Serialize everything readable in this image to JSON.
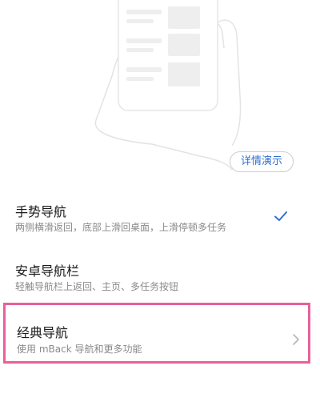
{
  "demo": {
    "label": "详情演示"
  },
  "options": [
    {
      "title": "手势导航",
      "description": "两侧横滑返回，底部上滑回桌面，上滑停顿多任务",
      "selected": true,
      "icon": "check-icon"
    },
    {
      "title": "安卓导航栏",
      "description": "轻触导航栏上返回、主页、多任务按钮",
      "selected": false
    },
    {
      "title": "经典导航",
      "description": "使用 mBack 导航和更多功能",
      "selected": false,
      "icon": "chevron-right-icon",
      "highlighted": true
    }
  ],
  "colors": {
    "accent": "#2f6fd1",
    "highlight_border": "#e8609a",
    "title_text": "#1a1a1a",
    "desc_text": "#8a8a8a"
  }
}
